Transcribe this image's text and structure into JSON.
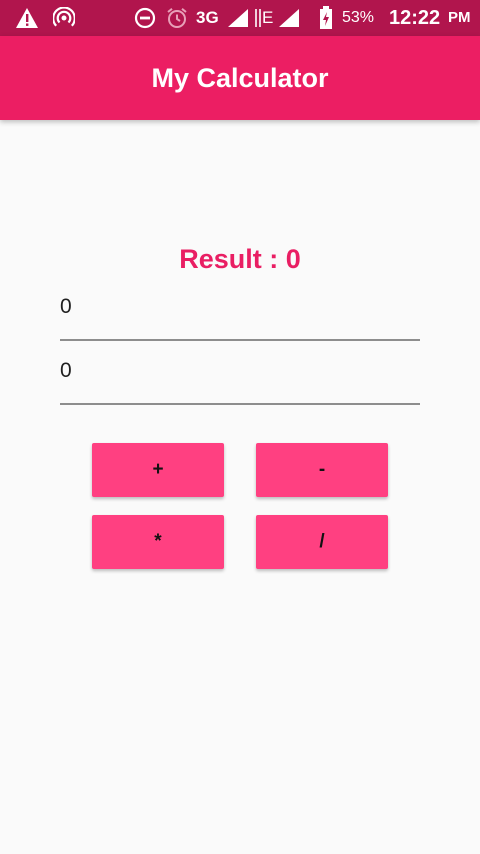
{
  "status_bar": {
    "network_type": "3G",
    "network_type_2": "E",
    "battery_percent": "53%",
    "time": "12:22",
    "time_suffix": "PM",
    "icons": [
      "warning-icon",
      "hotspot-icon",
      "do-not-disturb-icon",
      "alarm-icon",
      "signal-icon",
      "signal-icon-2",
      "battery-charging-icon"
    ]
  },
  "app_bar": {
    "title": "My Calculator"
  },
  "main": {
    "result_text": "Result : 0",
    "input_1_value": "0",
    "input_2_value": "0",
    "buttons": {
      "add_label": "+",
      "subtract_label": "-",
      "multiply_label": "*",
      "divide_label": "/"
    }
  },
  "colors": {
    "status_bar": "#b1154d",
    "primary": "#ec1e63",
    "accent": "#ff4081",
    "result_text": "#e91e63",
    "background": "#fafafa"
  }
}
